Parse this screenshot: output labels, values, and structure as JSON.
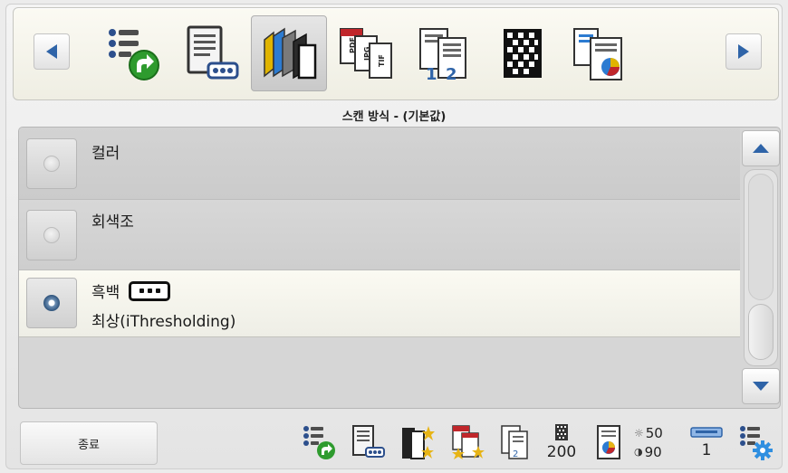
{
  "toolbar": {
    "prev_label": "◀",
    "next_label": "▶",
    "tools": [
      {
        "name": "shortcut-settings",
        "icon": "shortcut-list-icon",
        "selected": false
      },
      {
        "name": "document-settings",
        "icon": "document-dots-icon",
        "selected": false
      },
      {
        "name": "scan-mode",
        "icon": "color-pages-icon",
        "selected": true
      },
      {
        "name": "file-format",
        "icon": "pdf-jpg-tif-icon",
        "selected": false
      },
      {
        "name": "page-numbering",
        "icon": "page-order-icon",
        "selected": false
      },
      {
        "name": "resolution",
        "icon": "dot-grid-icon",
        "selected": false
      },
      {
        "name": "image-processing",
        "icon": "pie-document-icon",
        "selected": false
      }
    ]
  },
  "mode_title": "스캔 방식 - (기본값)",
  "options": [
    {
      "label": "컬러",
      "sub": "",
      "selected": false
    },
    {
      "label": "회색조",
      "sub": "",
      "selected": false
    },
    {
      "label": "흑백",
      "sub": "최상(iThresholding)",
      "selected": true
    }
  ],
  "footer": {
    "close_label": "종료",
    "resolution_value": "200",
    "brightness_value": "50",
    "contrast_value": "90",
    "copies_value": "1"
  },
  "colors": {
    "accent_blue": "#2f64a8",
    "green_arrow": "#2e9b2e",
    "selected_row": "#f7f6ee"
  }
}
